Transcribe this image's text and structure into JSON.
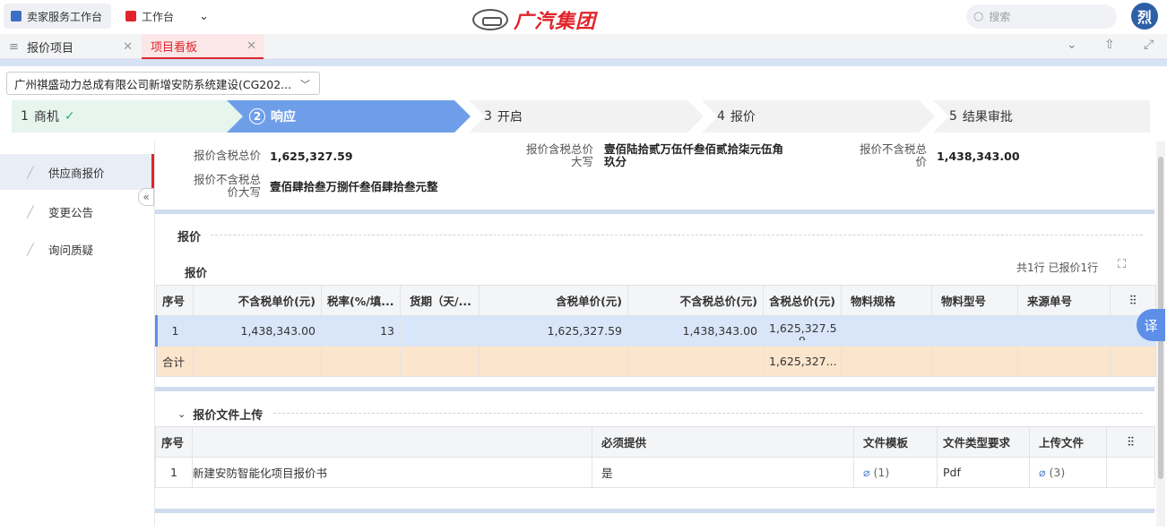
{
  "topbar": {
    "tab1": "卖家服务工作台",
    "tab2": "工作台",
    "logo_text": "广汽集团",
    "search_placeholder": "搜索",
    "avatar": "烈"
  },
  "page_tabs": [
    {
      "label": "报价项目"
    },
    {
      "label": "项目看板"
    }
  ],
  "project_select": "广州祺盛动力总成有限公司新增安防系统建设(CG202...",
  "steps": [
    {
      "num": "1",
      "label": "商机"
    },
    {
      "num": "2",
      "label": "响应"
    },
    {
      "num": "3",
      "label": "开启"
    },
    {
      "num": "4",
      "label": "报价"
    },
    {
      "num": "5",
      "label": "结果审批"
    }
  ],
  "sidebar": [
    {
      "label": "供应商报价"
    },
    {
      "label": "变更公告"
    },
    {
      "label": "询问质疑"
    }
  ],
  "summary": {
    "tax_total_label": "报价含税总价",
    "tax_total_value": "1,625,327.59",
    "tax_total_caps_label_1": "报价含税总价",
    "tax_total_caps_label_2": "大写",
    "tax_total_caps_value_1": "壹佰陆拾贰万伍仟叁佰贰拾柒元伍角",
    "tax_total_caps_value_2": "玖分",
    "notax_total_label_1": "报价不含税总",
    "notax_total_label_2": "价",
    "notax_total_value": "1,438,343.00",
    "notax_caps_label_1": "报价不含税总",
    "notax_caps_label_2": "价大写",
    "notax_caps_value": "壹佰肆拾叁万捌仟叁佰肆拾叁元整"
  },
  "quote_section": {
    "title": "报价",
    "tab": "报价",
    "status": "共1行 已报价1行",
    "columns": [
      "序号",
      "不含税单价(元)",
      "税率(%/填...",
      "货期（天/...",
      "含税单价(元)",
      "不含税总价(元)",
      "含税总价(元)",
      "物料规格",
      "物料型号",
      "来源单号"
    ],
    "row": {
      "seq": "1",
      "unit_notax": "1,438,343.00",
      "tax_rate": "13",
      "delivery": "",
      "unit_tax": "1,625,327.59",
      "total_notax": "1,438,343.00",
      "total_tax_1": "1,625,327.5",
      "total_tax_2": "9",
      "spec": "",
      "model": "",
      "source": ""
    },
    "sum_row": {
      "label": "合计",
      "total_tax": "1,625,327..."
    }
  },
  "upload_section": {
    "title": "报价文件上传",
    "columns": [
      "序号",
      "",
      "必须提供",
      "文件模板",
      "文件类型要求",
      "上传文件"
    ],
    "row": {
      "seq": "1",
      "name": "新建安防智能化项目报价书",
      "required": "是",
      "template": "(1)",
      "type": "Pdf",
      "uploaded": "(3)"
    }
  },
  "translate": "译",
  "colors": {
    "accent": "#e0242b",
    "step_active": "#6f9ee9",
    "step_done": "#e6f6ef",
    "band": "#cfdbee"
  }
}
